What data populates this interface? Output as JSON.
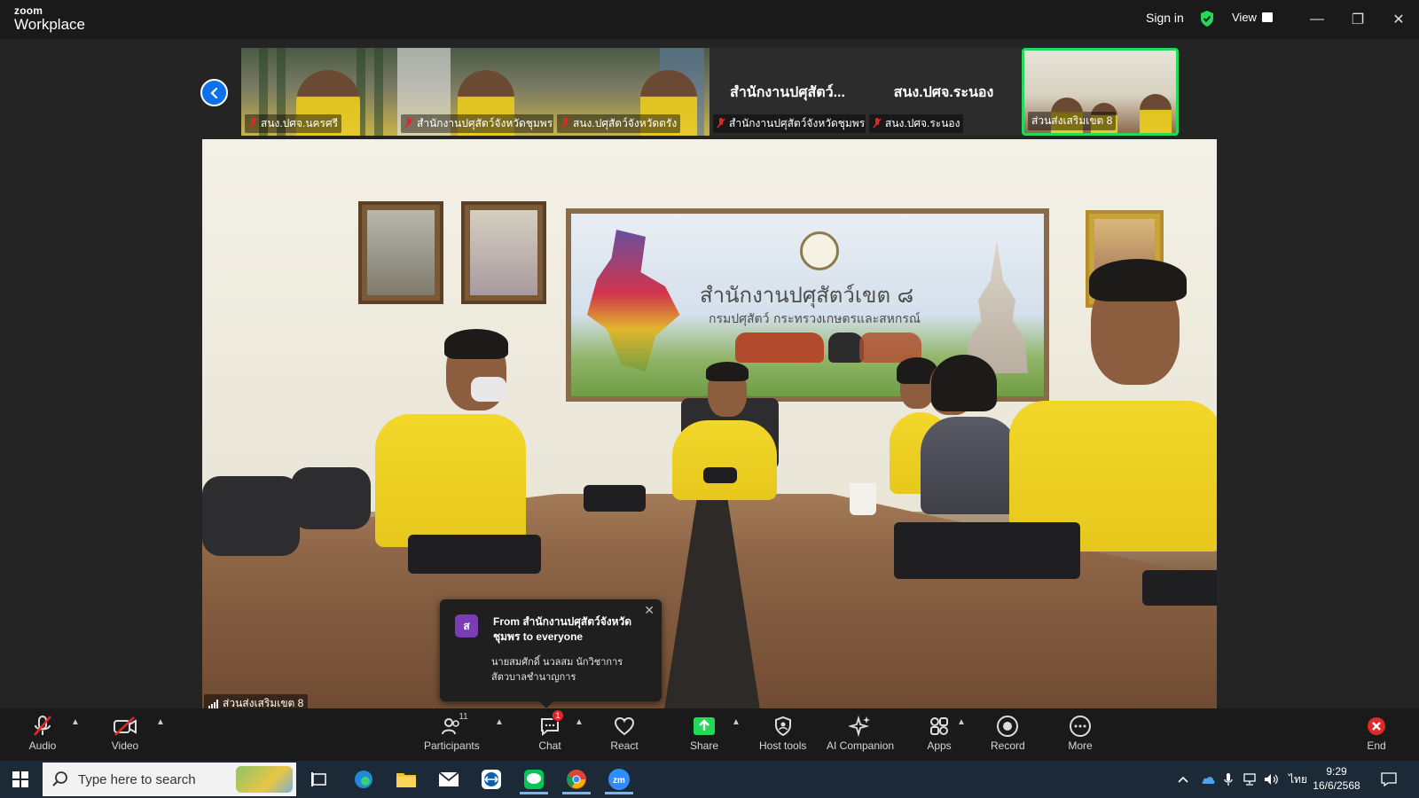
{
  "titlebar": {
    "logo_top": "zoom",
    "logo_bottom": "Workplace",
    "sign_in": "Sign in",
    "view": "View"
  },
  "thumbnails": [
    {
      "name": "สนง.ปศจ.นครศรี",
      "video": true,
      "muted": true
    },
    {
      "name": "สำนักงานปศุสัตว์จังหวัดชุมพร",
      "video": true,
      "muted": true
    },
    {
      "name": "สนง.ปศุสัตว์จังหวัดตรัง",
      "video": true,
      "muted": true
    },
    {
      "name": "สำนักงานปศุสัตว์จังหวัดชุมพร",
      "display_name": "สำนักงานปศุสัตว์...",
      "video": false,
      "muted": true
    },
    {
      "name": "สนง.ปศจ.ระนอง",
      "display_name": "สนง.ปศจ.ระนอง",
      "video": false,
      "muted": true
    },
    {
      "name": "ส่วนส่งเสริมเขต 8",
      "video": true,
      "muted": false,
      "active": true
    }
  ],
  "main_video": {
    "speaker": "ส่วนส่งเสริมเขต 8",
    "banner_title": "สำนักงานปศุสัตว์เขต ๘",
    "banner_subtitle": "กรมปศุสัตว์ กระทรวงเกษตรและสหกรณ์"
  },
  "chat_popup": {
    "avatar_letter": "ส",
    "from": "From สำนักงานปศุสัตว์จังหวัดชุมพร to everyone",
    "message": "นายสมศักดิ์ นวลสม นักวิชาการสัตวบาลชำนาญการ"
  },
  "toolbar": {
    "audio": "Audio",
    "video": "Video",
    "participants": "Participants",
    "participants_count": "11",
    "chat": "Chat",
    "chat_badge": "1",
    "react": "React",
    "share": "Share",
    "host_tools": "Host tools",
    "ai_companion": "AI Companion",
    "apps": "Apps",
    "record": "Record",
    "more": "More",
    "end": "End"
  },
  "taskbar": {
    "search_placeholder": "Type here to search",
    "language": "ไทย",
    "time": "9:29",
    "date": "16/6/2568"
  },
  "colors": {
    "accent_blue": "#0e71eb",
    "active_green": "#23d959",
    "share_green": "#23d959",
    "end_red": "#e02828",
    "mute_red": "#e02828"
  }
}
